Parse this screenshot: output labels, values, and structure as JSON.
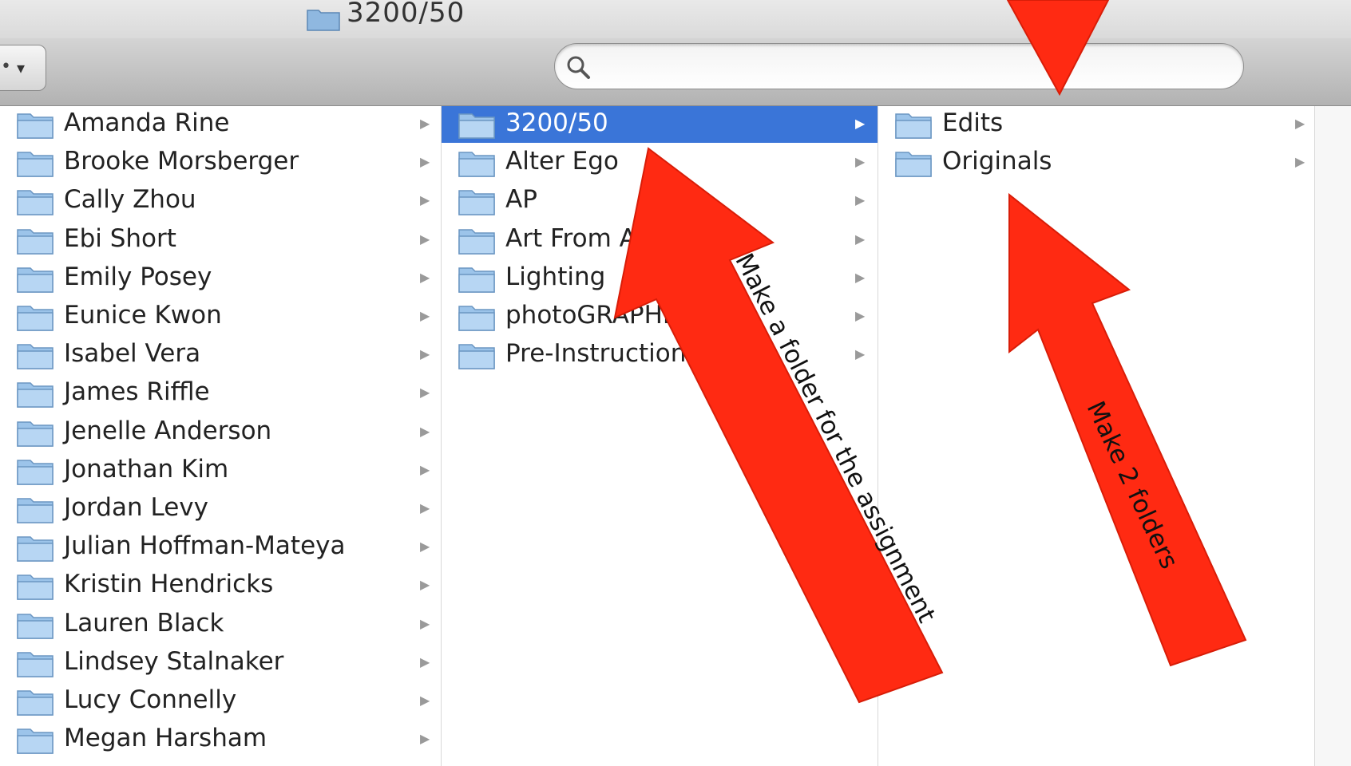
{
  "window": {
    "title": "3200/50"
  },
  "search": {
    "placeholder": ""
  },
  "columns": {
    "students": [
      "Amanda Rine",
      "Brooke Morsberger",
      "Cally Zhou",
      "Ebi Short",
      "Emily Posey",
      "Eunice Kwon",
      "Isabel Vera",
      "James Riffle",
      "Jenelle Anderson",
      "Jonathan Kim",
      "Jordan Levy",
      "Julian Hoffman-Mateya",
      "Kristin Hendricks",
      "Lauren Black",
      "Lindsey Stalnaker",
      "Lucy Connelly",
      "Megan Harsham"
    ],
    "assignments": [
      "3200/50",
      "Alter Ego",
      "AP",
      "Art From Art",
      "Lighting",
      "photoGRAPHIC",
      "Pre-Instructional"
    ],
    "assignments_selected": "3200/50",
    "subfolders": [
      "Edits",
      "Originals"
    ]
  },
  "annotations": {
    "arrow1_text": "Make a folder for the assignment",
    "arrow2_text": "Make 2 folders"
  },
  "colors": {
    "selection": "#3a75d8",
    "arrow_red": "#ff2a12"
  }
}
